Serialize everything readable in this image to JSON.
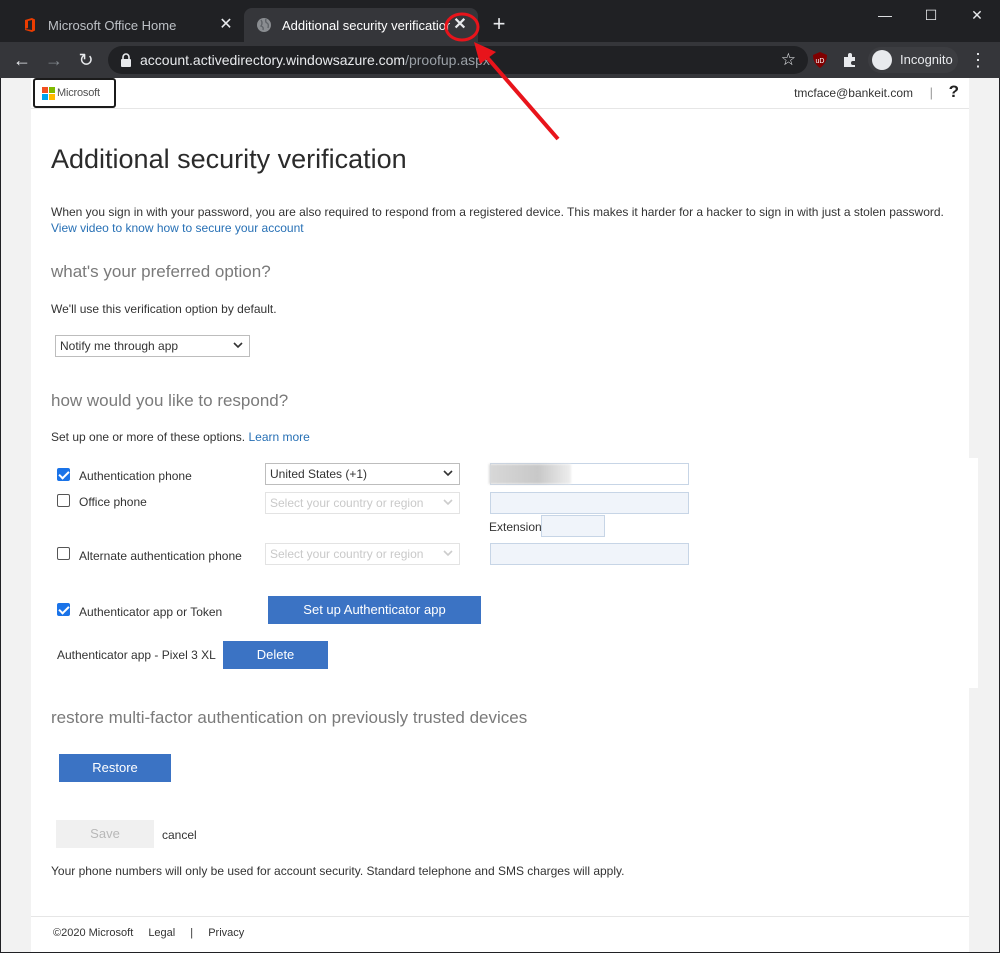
{
  "browser": {
    "tabs": [
      {
        "title": "Microsoft Office Home",
        "active": false
      },
      {
        "title": "Additional security verification",
        "active": true
      }
    ],
    "url_host": "account.activedirectory.windowsazure.com",
    "url_path": "/proofup.aspx",
    "incognito_label": "Incognito",
    "window_buttons": {
      "minimize": "—",
      "maximize": "☐",
      "close": "✕"
    }
  },
  "header": {
    "logo_text": "Microsoft",
    "user_email": "tmcface@bankeit.com",
    "separator": "|",
    "help": "?"
  },
  "main": {
    "title": "Additional security verification",
    "intro": "When you sign in with your password, you are also required to respond from a registered device. This makes it harder for a hacker to sign in with just a stolen password.",
    "video_link": "View video to know how to secure your account",
    "preferred": {
      "heading": "what's your preferred option?",
      "description": "We'll use this verification option by default.",
      "selected": "Notify me through app"
    },
    "respond": {
      "heading": "how would you like to respond?",
      "description": "Set up one or more of these options.",
      "learn_more": "Learn more",
      "options": [
        {
          "label": "Authentication phone",
          "checked": true,
          "country": "United States (+1)"
        },
        {
          "label": "Office phone",
          "checked": false,
          "country": "Select your country or region"
        },
        {
          "label": "Alternate authentication phone",
          "checked": false,
          "country": "Select your country or region"
        }
      ],
      "extension_label": "Extension",
      "authenticator": {
        "label": "Authenticator app or Token",
        "checked": true,
        "setup_button": "Set up Authenticator app",
        "device": "Authenticator app - Pixel 3 XL",
        "delete_button": "Delete"
      }
    },
    "restore": {
      "heading": "restore multi-factor authentication on previously trusted devices",
      "button": "Restore"
    },
    "save_button": "Save",
    "cancel_link": "cancel",
    "disclaimer": "Your phone numbers will only be used for account security. Standard telephone and SMS charges will apply."
  },
  "footer": {
    "copyright": "©2020 Microsoft",
    "legal": "Legal",
    "separator": "|",
    "privacy": "Privacy"
  },
  "colors": {
    "accent_button": "#3b73c4",
    "link": "#2770b5",
    "annotation": "#e8141b"
  }
}
